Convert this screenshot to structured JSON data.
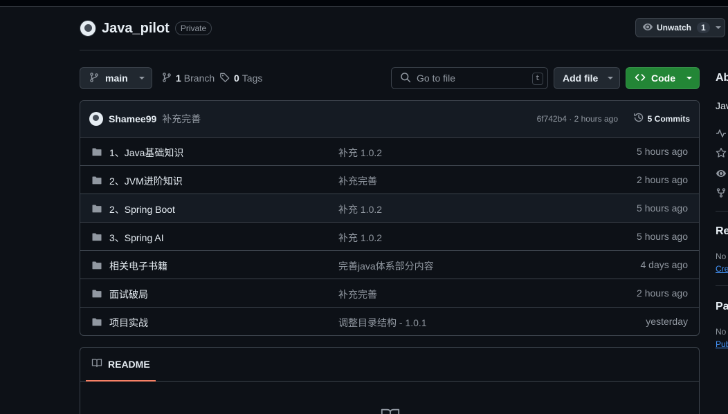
{
  "repo": {
    "name": "Java_pilot",
    "visibility": "Private"
  },
  "watch": {
    "label": "Unwatch",
    "count": "1"
  },
  "toolbar": {
    "branch": "main",
    "branches_count": "1",
    "branches_label": "Branch",
    "tags_count": "0",
    "tags_label": "Tags",
    "search_placeholder": "Go to file",
    "search_shortcut": "t",
    "add_file": "Add file",
    "code": "Code"
  },
  "commit": {
    "author": "Shamee99",
    "message": "补充完善",
    "hash_time": "6f742b4 · 2 hours ago",
    "commits": "5 Commits"
  },
  "files": [
    {
      "name": "1、Java基础知识",
      "message": "补充 1.0.2",
      "date": "5 hours ago"
    },
    {
      "name": "2、JVM进阶知识",
      "message": "补充完善",
      "date": "2 hours ago"
    },
    {
      "name": "2、Spring Boot",
      "message": "补充 1.0.2",
      "date": "5 hours ago"
    },
    {
      "name": "3、Spring AI",
      "message": "补充 1.0.2",
      "date": "5 hours ago"
    },
    {
      "name": "相关电子书籍",
      "message": "完善java体系部分内容",
      "date": "4 days ago"
    },
    {
      "name": "面试破局",
      "message": "补充完善",
      "date": "2 hours ago"
    },
    {
      "name": "项目实战",
      "message": "调整目录结构 - 1.0.1",
      "date": "yesterday"
    }
  ],
  "readme": {
    "tab": "README"
  },
  "sidebar": {
    "about_heading": "Ab",
    "about_desc": "Jav",
    "releases_heading": "Re",
    "releases_text": "No",
    "releases_link": "Cre",
    "packages_heading": "Pa",
    "packages_text": "No",
    "packages_link": "Pub"
  },
  "colors": {
    "bg": "#0d1117",
    "accent_green": "#238636",
    "link": "#4493f8",
    "tab_underline": "#f78166"
  }
}
